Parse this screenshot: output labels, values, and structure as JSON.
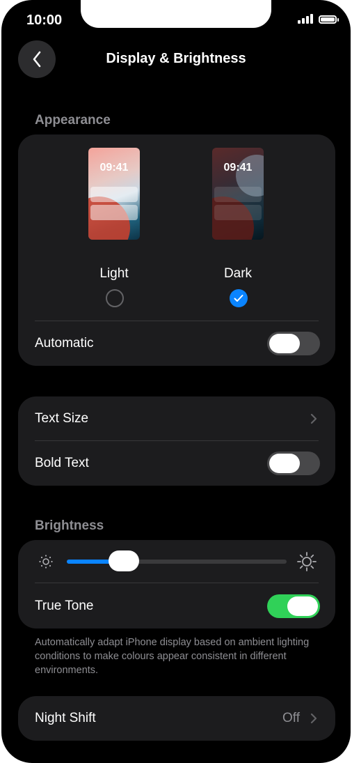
{
  "status_bar": {
    "time": "10:00"
  },
  "header": {
    "title": "Display & Brightness"
  },
  "appearance": {
    "section_label": "Appearance",
    "light": {
      "label": "Light",
      "preview_time": "09:41",
      "selected": false
    },
    "dark": {
      "label": "Dark",
      "preview_time": "09:41",
      "selected": true
    },
    "automatic_label": "Automatic",
    "automatic_on": false
  },
  "text": {
    "text_size_label": "Text Size",
    "bold_text_label": "Bold Text",
    "bold_text_on": false
  },
  "brightness": {
    "section_label": "Brightness",
    "level": 0.22,
    "true_tone_label": "True Tone",
    "true_tone_on": true,
    "footnote": "Automatically adapt iPhone display based on ambient lighting conditions to make colours appear consistent in different environments."
  },
  "night_shift": {
    "label": "Night Shift",
    "value": "Off"
  },
  "colors": {
    "accent": "#0a84ff",
    "toggle_on": "#30d158",
    "card": "#1c1c1e",
    "secondary_text": "#8e8e93"
  }
}
